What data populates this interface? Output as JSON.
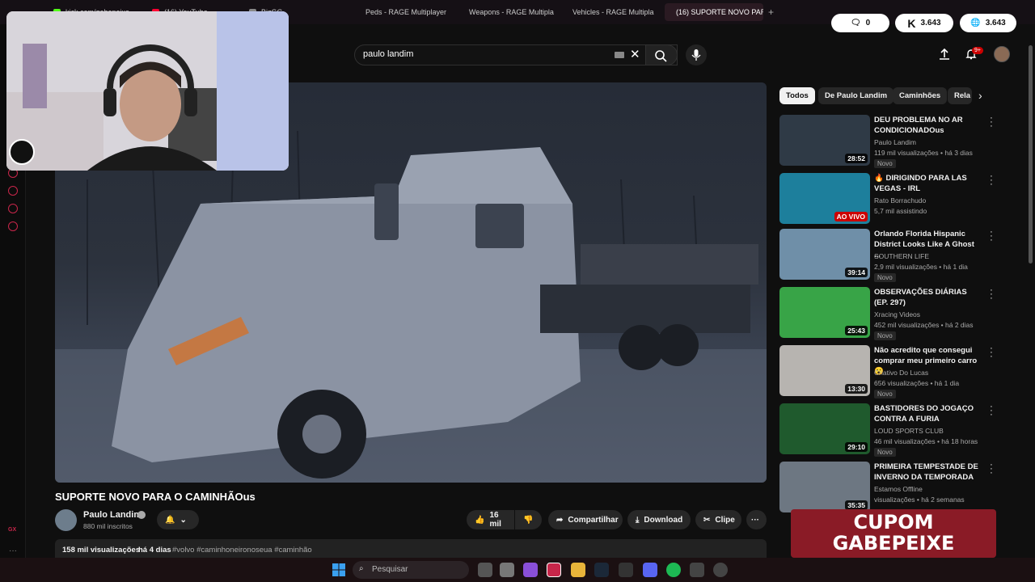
{
  "browser": {
    "tabs": [
      {
        "label": "kick.com/gabepeixe",
        "color": "#53fc18"
      },
      {
        "label": "(16) YouTube",
        "color": "#ff0033"
      },
      {
        "label": "BizGG",
        "color": "#888"
      },
      {
        "label": "Peds - RAGE Multiplayer",
        "color": "#e0b020"
      },
      {
        "label": "Weapons - RAGE Multipla",
        "color": "#e0b020"
      },
      {
        "label": "Vehicles - RAGE Multipla",
        "color": "#e0b020"
      },
      {
        "label": "(16) SUPORTE NOVO PAR",
        "color": "#ff0033"
      }
    ]
  },
  "header": {
    "search_value": "paulo landim",
    "notifications_badge": "9+"
  },
  "pills": {
    "messages": "0",
    "kick_count": "3.643",
    "globe_count": "3.643"
  },
  "video": {
    "title": "SUPORTE NOVO PARA O CAMINHÃOus",
    "channel": "Paulo Landim",
    "subscribers": "880 mil inscritos",
    "likes": "16 mil",
    "share_label": "Compartilhar",
    "download_label": "Download",
    "clip_label": "Clipe",
    "views": "158 mil visualizações",
    "age": "há 4 dias",
    "hashtags": "#volvo #caminhoneironoseua #caminhão"
  },
  "chips": [
    "Todos",
    "De Paulo Landim",
    "Caminhões",
    "Rela"
  ],
  "recommendations": [
    {
      "title": "DEU PROBLEMA NO AR CONDICIONADOus",
      "channel": "Paulo Landim",
      "meta": "119 mil visualizações • há 3 dias",
      "badge": "Novo",
      "duration": "28:52",
      "thumb": "#2f3a46"
    },
    {
      "title": "🔥 DIRIGINDO PARA LAS VEGAS - IRL",
      "channel": "Rato Borrachudo",
      "meta": "5,7 mil assistindo",
      "badge": "",
      "duration": "AO VIVO",
      "thumb": "#1d7f9c"
    },
    {
      "title": "Orlando Florida Hispanic District Looks Like A Ghost ...",
      "channel": "SOUTHERN LIFE",
      "meta": "2,9 mil visualizações • há 1 dia",
      "badge": "Novo",
      "duration": "39:14",
      "thumb": "#6f8fa8"
    },
    {
      "title": "OBSERVAÇÕES DIÁRIAS (EP. 297)",
      "channel": "Xracing Videos",
      "meta": "452 mil visualizações • há 2 dias",
      "badge": "Novo",
      "duration": "25:43",
      "thumb": "#38a447"
    },
    {
      "title": "Não acredito que consegui comprar meu primeiro carro 😮",
      "channel": "Criativo Do Lucas",
      "meta": "656 visualizações • há 1 dia",
      "badge": "Novo",
      "duration": "13:30",
      "thumb": "#b7b4b0"
    },
    {
      "title": "BASTIDORES DO JOGAÇO CONTRA A FURIA",
      "channel": "LOUD SPORTS CLUB",
      "meta": "46 mil visualizações • há 18 horas",
      "badge": "Novo",
      "duration": "29:10",
      "thumb": "#1f5a2d"
    },
    {
      "title": "PRIMEIRA TEMPESTADE DE INVERNO DA TEMPORADA",
      "channel": "Estamos Offline",
      "meta": "visualizações • há 2 semanas",
      "badge": "",
      "duration": "35:35",
      "thumb": "#6d7782"
    }
  ],
  "overlay": {
    "cupom_line1": "CUPOM",
    "cupom_line2": "GABEPEIXE",
    "gx_label": "GX"
  },
  "taskbar": {
    "search_placeholder": "Pesquisar"
  }
}
